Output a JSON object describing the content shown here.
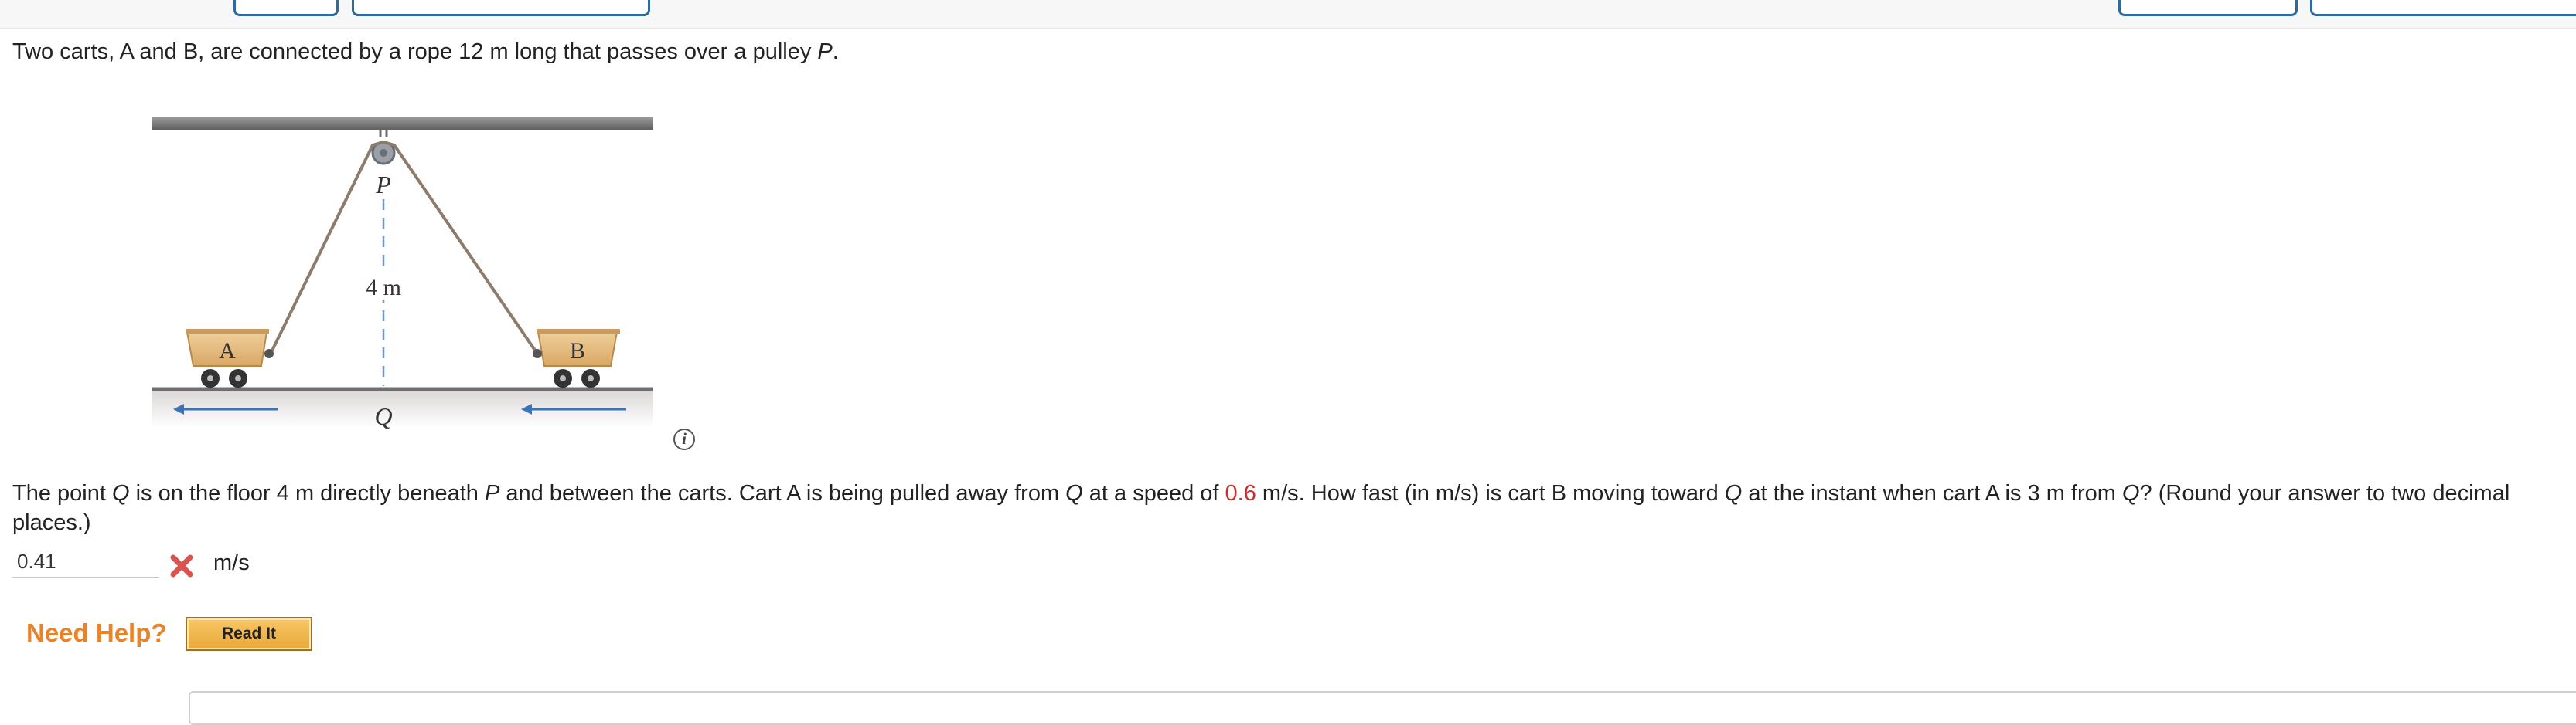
{
  "problem": {
    "intro_prefix": "Two carts, A and B, are connected by a rope 12 m long that passes over a pulley",
    "intro_pulley": "P",
    "intro_suffix": "."
  },
  "figure": {
    "pulley_label": "P",
    "height_label": "4 m",
    "point_label": "Q",
    "cart_a_label": "A",
    "cart_b_label": "B",
    "colors": {
      "cart": "#e2b57a",
      "rope": "#8d7b6b",
      "arrow": "#3a74b8",
      "ceiling": "#7a7a7a"
    }
  },
  "question": {
    "t1": "The point ",
    "q1": "Q",
    "t2": " is on the floor 4 m directly beneath ",
    "p1": "P",
    "t3": " and between the carts. Cart A is being pulled away from ",
    "q2": "Q",
    "t4": " at a speed of ",
    "speed": "0.6",
    "t5": " m/s. How fast (in m/s) is cart B moving toward ",
    "q3": "Q",
    "t6": " at the instant when cart A is 3 m from ",
    "q4": "Q",
    "t7": "? (Round your answer to two decimal places.)"
  },
  "answer": {
    "value": "0.41",
    "status_icon": "incorrect-x-icon",
    "unit": "m/s"
  },
  "help": {
    "label": "Need Help?",
    "read_it": "Read It"
  },
  "info_icon": "info-icon"
}
